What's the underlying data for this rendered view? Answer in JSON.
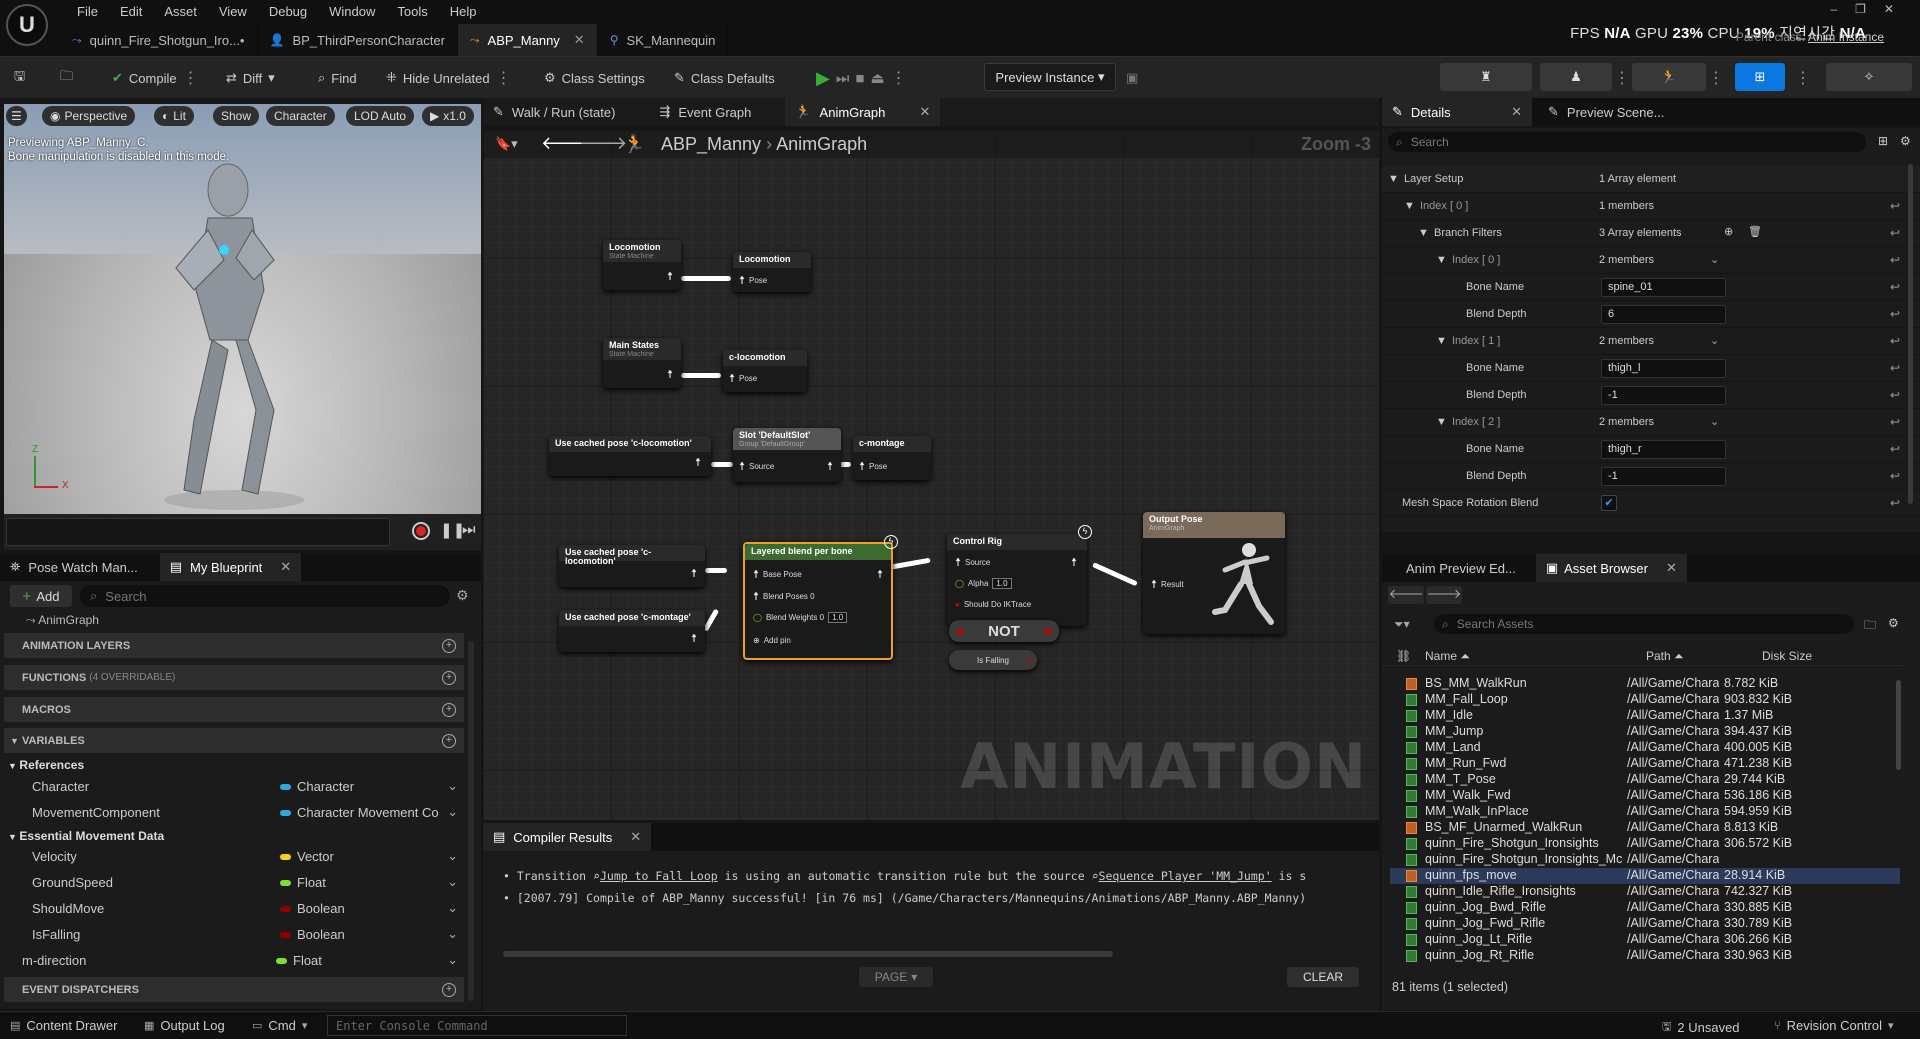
{
  "menu": [
    "File",
    "Edit",
    "Asset",
    "View",
    "Debug",
    "Window",
    "Tools",
    "Help"
  ],
  "tabs": [
    {
      "label": "quinn_Fire_Shotgun_Iro...•",
      "active": false
    },
    {
      "label": "BP_ThirdPersonCharacter",
      "active": false
    },
    {
      "label": "ABP_Manny",
      "active": true
    },
    {
      "label": "SK_Mannequin",
      "active": false
    }
  ],
  "perf": {
    "fps_label": "FPS",
    "fps_val": "N/A",
    "gpu_label": "GPU",
    "gpu_val": "23%",
    "cpu_label": "CPU",
    "cpu_val": "19%",
    "time_label": "지연시간",
    "time_val": "N/A"
  },
  "parent_class": {
    "label": "Parent class:",
    "value": "Anim Instance"
  },
  "toolbar": {
    "compile": "Compile",
    "diff": "Diff",
    "find": "Find",
    "hide_unrelated": "Hide Unrelated",
    "class_settings": "Class Settings",
    "class_defaults": "Class Defaults",
    "preview_instance": "Preview Instance"
  },
  "viewport": {
    "perspective": "Perspective",
    "lit": "Lit",
    "show": "Show",
    "character": "Character",
    "lod": "LOD Auto",
    "speed": "x1.0",
    "line1": "Previewing ABP_Manny_C.",
    "line2": "Bone manipulation is disabled in this mode."
  },
  "graph_tabs": [
    {
      "label": "Walk / Run (state)",
      "active": false
    },
    {
      "label": "Event Graph",
      "active": false
    },
    {
      "label": "AnimGraph",
      "active": true
    }
  ],
  "breadcrumb": {
    "root": "ABP_Manny",
    "leaf": "AnimGraph",
    "zoom": "Zoom -3"
  },
  "watermark": "ANIMATION",
  "nodes": {
    "loco_sm": {
      "title": "Locomotion",
      "sub": "State Machine"
    },
    "loco_cache": {
      "title": "Locomotion",
      "pin": "Pose"
    },
    "main_sm": {
      "title": "Main States",
      "sub": "State Machine"
    },
    "c_loco": {
      "title": "c-locomotion",
      "pin": "Pose"
    },
    "use_cached1": {
      "title": "Use cached pose 'c-locomotion'"
    },
    "slot": {
      "title": "Slot 'DefaultSlot'",
      "sub": "Group 'DefaultGroup'",
      "pin": "Source"
    },
    "c_montage": {
      "title": "c-montage",
      "pin": "Pose"
    },
    "use_cached2": {
      "title": "Use cached pose 'c-locomotion'"
    },
    "use_cached3": {
      "title": "Use cached pose 'c-montage'"
    },
    "layered": {
      "title": "Layered blend per bone",
      "pins": [
        "Base Pose",
        "Blend Poses 0",
        "Blend Weights 0"
      ],
      "weight": "1.0",
      "add_pin": "Add pin"
    },
    "control_rig": {
      "title": "Control Rig",
      "pins": [
        "Source",
        "Alpha",
        "Should Do IKTrace"
      ],
      "alpha": "1.0"
    },
    "not_node": "NOT",
    "is_falling": "Is Falling",
    "output": {
      "title": "Output Pose",
      "sub": "AnimGraph",
      "pin": "Result"
    }
  },
  "left_tabs": [
    {
      "label": "Pose Watch Man..."
    },
    {
      "label": "My Blueprint"
    }
  ],
  "my_blueprint": {
    "add": "Add",
    "search_ph": "Search",
    "tree_root": "AnimGraph",
    "sections": {
      "anim_layers": "ANIMATION LAYERS",
      "functions": "FUNCTIONS",
      "functions_note": "(4 OVERRIDABLE)",
      "macros": "MACROS",
      "variables": "VARIABLES",
      "dispatchers": "EVENT DISPATCHERS"
    },
    "groups": {
      "references": "References",
      "essential": "Essential Movement Data"
    },
    "vars": [
      {
        "name": "Character",
        "type": "Character",
        "color": "#2fa8e0"
      },
      {
        "name": "MovementComponent",
        "type": "Character Movement Co",
        "color": "#2fa8e0"
      },
      {
        "name": "Velocity",
        "type": "Vector",
        "color": "#f4d21a"
      },
      {
        "name": "GroundSpeed",
        "type": "Float",
        "color": "#7de02f"
      },
      {
        "name": "ShouldMove",
        "type": "Boolean",
        "color": "#8e0000"
      },
      {
        "name": "IsFalling",
        "type": "Boolean",
        "color": "#8e0000"
      },
      {
        "name": "m-direction",
        "type": "Float",
        "color": "#7de02f"
      }
    ]
  },
  "right_tabs": [
    {
      "label": "Details"
    },
    {
      "label": "Preview Scene..."
    }
  ],
  "details": {
    "search_ph": "Search",
    "rows": [
      {
        "k": "Layer Setup",
        "v": "1 Array element"
      },
      {
        "k": "Index [ 0 ]",
        "v": "1 members"
      },
      {
        "k": "Branch Filters",
        "v": "3 Array elements"
      },
      {
        "k": "Index [ 0 ]",
        "v": "2 members"
      },
      {
        "k": "Bone Name",
        "v": "spine_01"
      },
      {
        "k": "Blend Depth",
        "v": "6"
      },
      {
        "k": "Index [ 1 ]",
        "v": "2 members"
      },
      {
        "k": "Bone Name",
        "v": "thigh_l"
      },
      {
        "k": "Blend Depth",
        "v": "-1"
      },
      {
        "k": "Index [ 2 ]",
        "v": "2 members"
      },
      {
        "k": "Bone Name",
        "v": "thigh_r"
      },
      {
        "k": "Blend Depth",
        "v": "-1"
      },
      {
        "k": "Mesh Space Rotation Blend",
        "v": "✔"
      }
    ]
  },
  "asset_tabs": [
    {
      "label": "Anim Preview Ed..."
    },
    {
      "label": "Asset Browser"
    }
  ],
  "assets": {
    "search_ph": "Search Assets",
    "col_name": "Name",
    "col_path": "Path",
    "col_size": "Disk Size",
    "items": [
      {
        "n": "BS_MM_WalkRun",
        "p": "/All/Game/Charact",
        "s": "8.782 KiB",
        "t": "bs"
      },
      {
        "n": "MM_Fall_Loop",
        "p": "/All/Game/Charact",
        "s": "903.832 KiB",
        "t": "a"
      },
      {
        "n": "MM_Idle",
        "p": "/All/Game/Charact",
        "s": "1.37 MiB",
        "t": "a"
      },
      {
        "n": "MM_Jump",
        "p": "/All/Game/Charact",
        "s": "394.437 KiB",
        "t": "a"
      },
      {
        "n": "MM_Land",
        "p": "/All/Game/Charact",
        "s": "400.005 KiB",
        "t": "a"
      },
      {
        "n": "MM_Run_Fwd",
        "p": "/All/Game/Charact",
        "s": "471.238 KiB",
        "t": "a"
      },
      {
        "n": "MM_T_Pose",
        "p": "/All/Game/Charact",
        "s": "29.744 KiB",
        "t": "a"
      },
      {
        "n": "MM_Walk_Fwd",
        "p": "/All/Game/Charact",
        "s": "536.186 KiB",
        "t": "a"
      },
      {
        "n": "MM_Walk_InPlace",
        "p": "/All/Game/Charact",
        "s": "594.959 KiB",
        "t": "a"
      },
      {
        "n": "BS_MF_Unarmed_WalkRun",
        "p": "/All/Game/Charact",
        "s": "8.813 KiB",
        "t": "bs"
      },
      {
        "n": "quinn_Fire_Shotgun_Ironsights",
        "p": "/All/Game/Charact",
        "s": "306.572 KiB",
        "t": "a"
      },
      {
        "n": "quinn_Fire_Shotgun_Ironsights_Mc",
        "p": "/All/Game/Charact",
        "s": "",
        "t": "a"
      },
      {
        "n": "quinn_fps_move",
        "p": "/All/Game/Charact",
        "s": "28.914 KiB",
        "t": "bs",
        "sel": true
      },
      {
        "n": "quinn_Idle_Rifle_Ironsights",
        "p": "/All/Game/Charact",
        "s": "742.327 KiB",
        "t": "a"
      },
      {
        "n": "quinn_Jog_Bwd_Rifle",
        "p": "/All/Game/Charact",
        "s": "330.885 KiB",
        "t": "a"
      },
      {
        "n": "quinn_Jog_Fwd_Rifle",
        "p": "/All/Game/Charact",
        "s": "330.789 KiB",
        "t": "a"
      },
      {
        "n": "quinn_Jog_Lt_Rifle",
        "p": "/All/Game/Charact",
        "s": "306.266 KiB",
        "t": "a"
      },
      {
        "n": "quinn_Jog_Rt_Rifle",
        "p": "/All/Game/Charact",
        "s": "330.963 KiB",
        "t": "a"
      }
    ],
    "footer": "81 items (1 selected)"
  },
  "compiler": {
    "tab": "Compiler Results",
    "line1_a": "Transition",
    "line1_link1": "Jump to Fall Loop",
    "line1_b": "is using an automatic transition rule but the source",
    "line1_link2": "Sequence Player 'MM_Jump'",
    "line1_c": "is s",
    "line2": "[2007.79] Compile of ABP_Manny successful! [in 76 ms] (/Game/Characters/Mannequins/Animations/ABP_Manny.ABP_Manny)",
    "page": "PAGE",
    "clear": "CLEAR"
  },
  "status": {
    "content_drawer": "Content Drawer",
    "output_log": "Output Log",
    "cmd": "Cmd",
    "console_ph": "Enter Console Command",
    "unsaved": "2 Unsaved",
    "revision": "Revision Control"
  }
}
